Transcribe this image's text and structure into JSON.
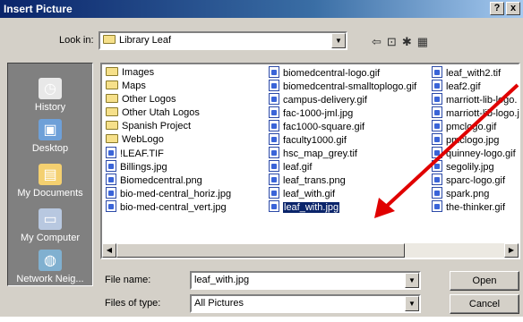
{
  "window": {
    "title": "Insert Picture",
    "help_label": "?",
    "close_label": "x"
  },
  "toolbar": {
    "lookin_label": "Look in:",
    "lookin_value": "Library Leaf",
    "icons": [
      "back-icon",
      "up-folder-icon",
      "new-folder-icon",
      "views-icon"
    ]
  },
  "places": [
    {
      "label": "History",
      "icon": "history-icon"
    },
    {
      "label": "Desktop",
      "icon": "desktop-icon"
    },
    {
      "label": "My Documents",
      "icon": "my-documents-icon"
    },
    {
      "label": "My Computer",
      "icon": "my-computer-icon"
    },
    {
      "label": "Network Neig...",
      "icon": "network-icon"
    }
  ],
  "files": {
    "column1": [
      {
        "name": "Images",
        "type": "folder"
      },
      {
        "name": "Maps",
        "type": "folder"
      },
      {
        "name": "Other Logos",
        "type": "folder"
      },
      {
        "name": "Other Utah Logos",
        "type": "folder"
      },
      {
        "name": "Spanish Project",
        "type": "folder"
      },
      {
        "name": "WebLogo",
        "type": "folder"
      },
      {
        "name": "!LEAF.TIF",
        "type": "image"
      },
      {
        "name": "Billings.jpg",
        "type": "image"
      },
      {
        "name": "Biomedcentral.png",
        "type": "image"
      },
      {
        "name": "bio-med-central_horiz.jpg",
        "type": "image"
      },
      {
        "name": "bio-med-central_vert.jpg",
        "type": "image"
      }
    ],
    "column2": [
      {
        "name": "biomedcentral-logo.gif",
        "type": "image"
      },
      {
        "name": "biomedcentral-smalltoplogo.gif",
        "type": "image"
      },
      {
        "name": "campus-delivery.gif",
        "type": "image"
      },
      {
        "name": "fac-1000-jml.jpg",
        "type": "image"
      },
      {
        "name": "fac1000-square.gif",
        "type": "image"
      },
      {
        "name": "faculty1000.gif",
        "type": "image"
      },
      {
        "name": "hsc_map_grey.tif",
        "type": "image"
      },
      {
        "name": "leaf.gif",
        "type": "image"
      },
      {
        "name": "leaf_trans.png",
        "type": "image"
      },
      {
        "name": "leaf_with.gif",
        "type": "image"
      },
      {
        "name": "leaf_with.jpg",
        "type": "image",
        "selected": true
      }
    ],
    "column3": [
      {
        "name": "leaf_with2.tif",
        "type": "image"
      },
      {
        "name": "leaf2.gif",
        "type": "image"
      },
      {
        "name": "marriott-lib-logo.",
        "type": "image"
      },
      {
        "name": "marriott-lib-logo.j",
        "type": "image"
      },
      {
        "name": "pmclogo.gif",
        "type": "image"
      },
      {
        "name": "pmclogo.jpg",
        "type": "image"
      },
      {
        "name": "quinney-logo.gif",
        "type": "image"
      },
      {
        "name": "segolily.jpg",
        "type": "image"
      },
      {
        "name": "sparc-logo.gif",
        "type": "image"
      },
      {
        "name": "spark.png",
        "type": "image"
      },
      {
        "name": "the-thinker.gif",
        "type": "image"
      }
    ]
  },
  "filename": {
    "label": "File name:",
    "value": "leaf_with.jpg"
  },
  "filetype": {
    "label": "Files of type:",
    "value": "All Pictures"
  },
  "buttons": {
    "open": "Open",
    "cancel": "Cancel"
  },
  "annotation": {
    "color": "#e00000"
  }
}
